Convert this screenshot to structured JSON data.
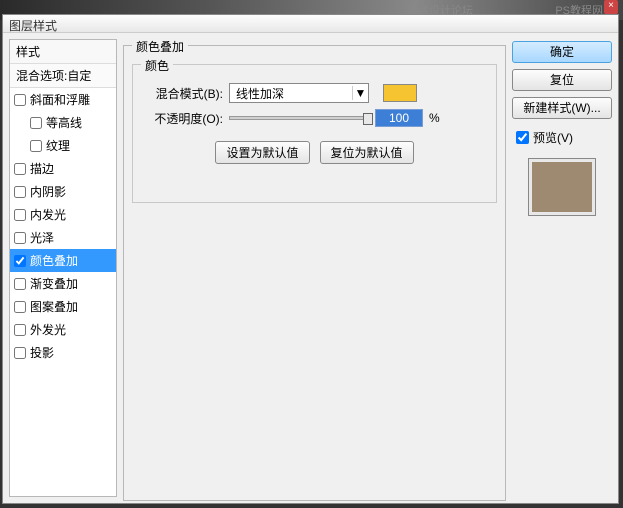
{
  "backdrop": {
    "watermark_left": "思缘设计论坛",
    "watermark_right": "PS教程网"
  },
  "dialog": {
    "title": "图层样式"
  },
  "sidebar": {
    "header": "样式",
    "sub": "混合选项:自定",
    "items": [
      {
        "label": "斜面和浮雕",
        "checked": false,
        "indent": false
      },
      {
        "label": "等高线",
        "checked": false,
        "indent": true
      },
      {
        "label": "纹理",
        "checked": false,
        "indent": true
      },
      {
        "label": "描边",
        "checked": false,
        "indent": false
      },
      {
        "label": "内阴影",
        "checked": false,
        "indent": false
      },
      {
        "label": "内发光",
        "checked": false,
        "indent": false
      },
      {
        "label": "光泽",
        "checked": false,
        "indent": false
      },
      {
        "label": "颜色叠加",
        "checked": true,
        "indent": false,
        "selected": true
      },
      {
        "label": "渐变叠加",
        "checked": false,
        "indent": false
      },
      {
        "label": "图案叠加",
        "checked": false,
        "indent": false
      },
      {
        "label": "外发光",
        "checked": false,
        "indent": false
      },
      {
        "label": "投影",
        "checked": false,
        "indent": false
      }
    ]
  },
  "main": {
    "group_title": "颜色叠加",
    "inner_title": "颜色",
    "blend_label": "混合模式(B):",
    "blend_value": "线性加深",
    "opacity_label": "不透明度(O):",
    "opacity_value": "100",
    "opacity_unit": "%",
    "default_btn": "设置为默认值",
    "reset_btn": "复位为默认值",
    "swatch_color": "#f5c430"
  },
  "right": {
    "ok": "确定",
    "reset": "复位",
    "new_style": "新建样式(W)...",
    "preview": "预览(V)",
    "preview_color": "#9d8a70"
  }
}
